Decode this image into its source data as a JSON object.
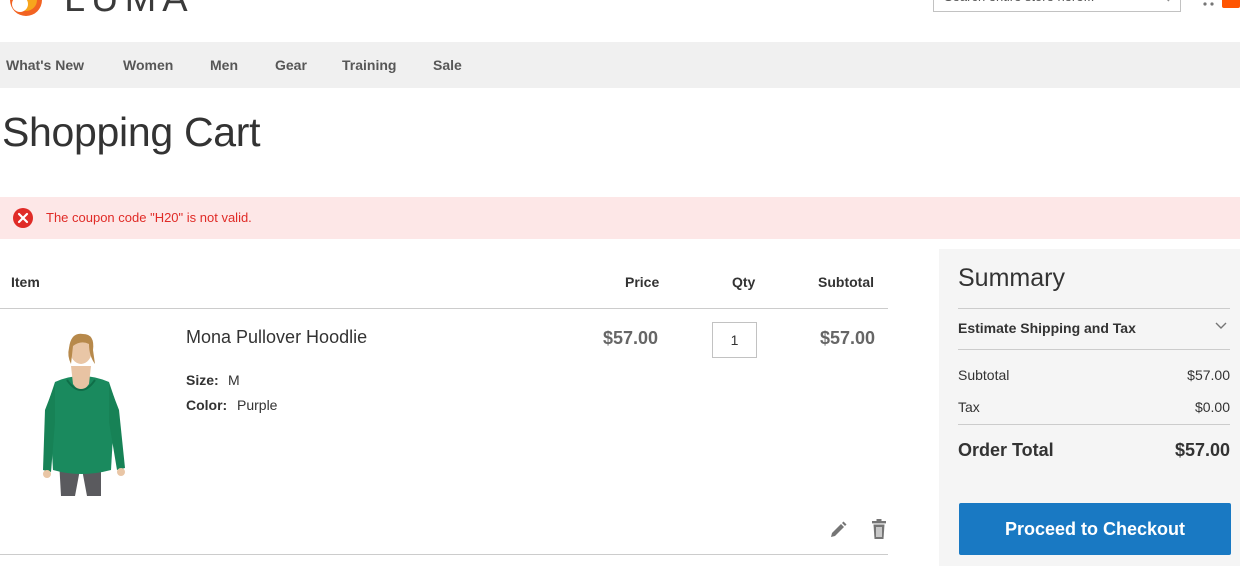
{
  "header": {
    "logo_text": "LUMA",
    "search_placeholder": "Search entire store here...",
    "accent_color": "#ff5501"
  },
  "nav": {
    "items": [
      "What's New",
      "Women",
      "Men",
      "Gear",
      "Training",
      "Sale"
    ]
  },
  "page": {
    "title": "Shopping Cart"
  },
  "message": {
    "type": "error",
    "text": "The coupon code \"H20\" is not valid.",
    "icon": "error-x-icon",
    "color": "#e02b27"
  },
  "cart": {
    "columns": {
      "item": "Item",
      "price": "Price",
      "qty": "Qty",
      "subtotal": "Subtotal"
    },
    "items": [
      {
        "name": "Mona Pullover Hoodlie",
        "options": [
          {
            "label": "Size:",
            "value": "M"
          },
          {
            "label": "Color:",
            "value": "Purple"
          }
        ],
        "price": "$57.00",
        "qty": "1",
        "subtotal": "$57.00",
        "actions": [
          "edit-icon",
          "trash-icon"
        ]
      }
    ]
  },
  "summary": {
    "title": "Summary",
    "estimate_label": "Estimate Shipping and Tax",
    "rows": [
      {
        "label": "Subtotal",
        "value": "$57.00"
      },
      {
        "label": "Tax",
        "value": "$0.00"
      }
    ],
    "total_label": "Order Total",
    "total_value": "$57.00",
    "checkout_label": "Proceed to Checkout",
    "button_color": "#1979c3"
  }
}
